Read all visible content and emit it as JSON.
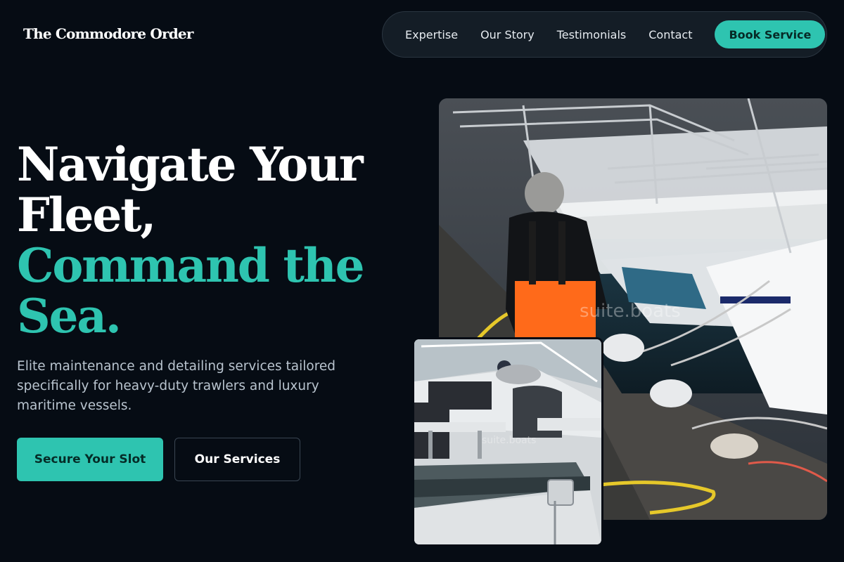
{
  "brand": {
    "name": "The Commodore Order"
  },
  "nav": {
    "links": [
      "Expertise",
      "Our Story",
      "Testimonials",
      "Contact"
    ],
    "cta": "Book Service"
  },
  "hero": {
    "title_line1": "Navigate Your",
    "title_line2": "Fleet,",
    "title_line3": "Command the",
    "title_line4": "Sea.",
    "subtitle": "Elite maintenance and detailing services tailored specifically for heavy-duty trawlers and luxury maritime vessels.",
    "primary_cta": "Secure Your Slot",
    "secondary_cta": "Our Services"
  },
  "images": {
    "main_alt": "Worker in orange overalls on a marina dock beside moored boats",
    "small_alt": "Boat interior with seating and steering console",
    "watermark": "suite.boats"
  },
  "colors": {
    "background": "#060c14",
    "accent": "#2ec4b0",
    "nav_bg": "#141d26"
  }
}
